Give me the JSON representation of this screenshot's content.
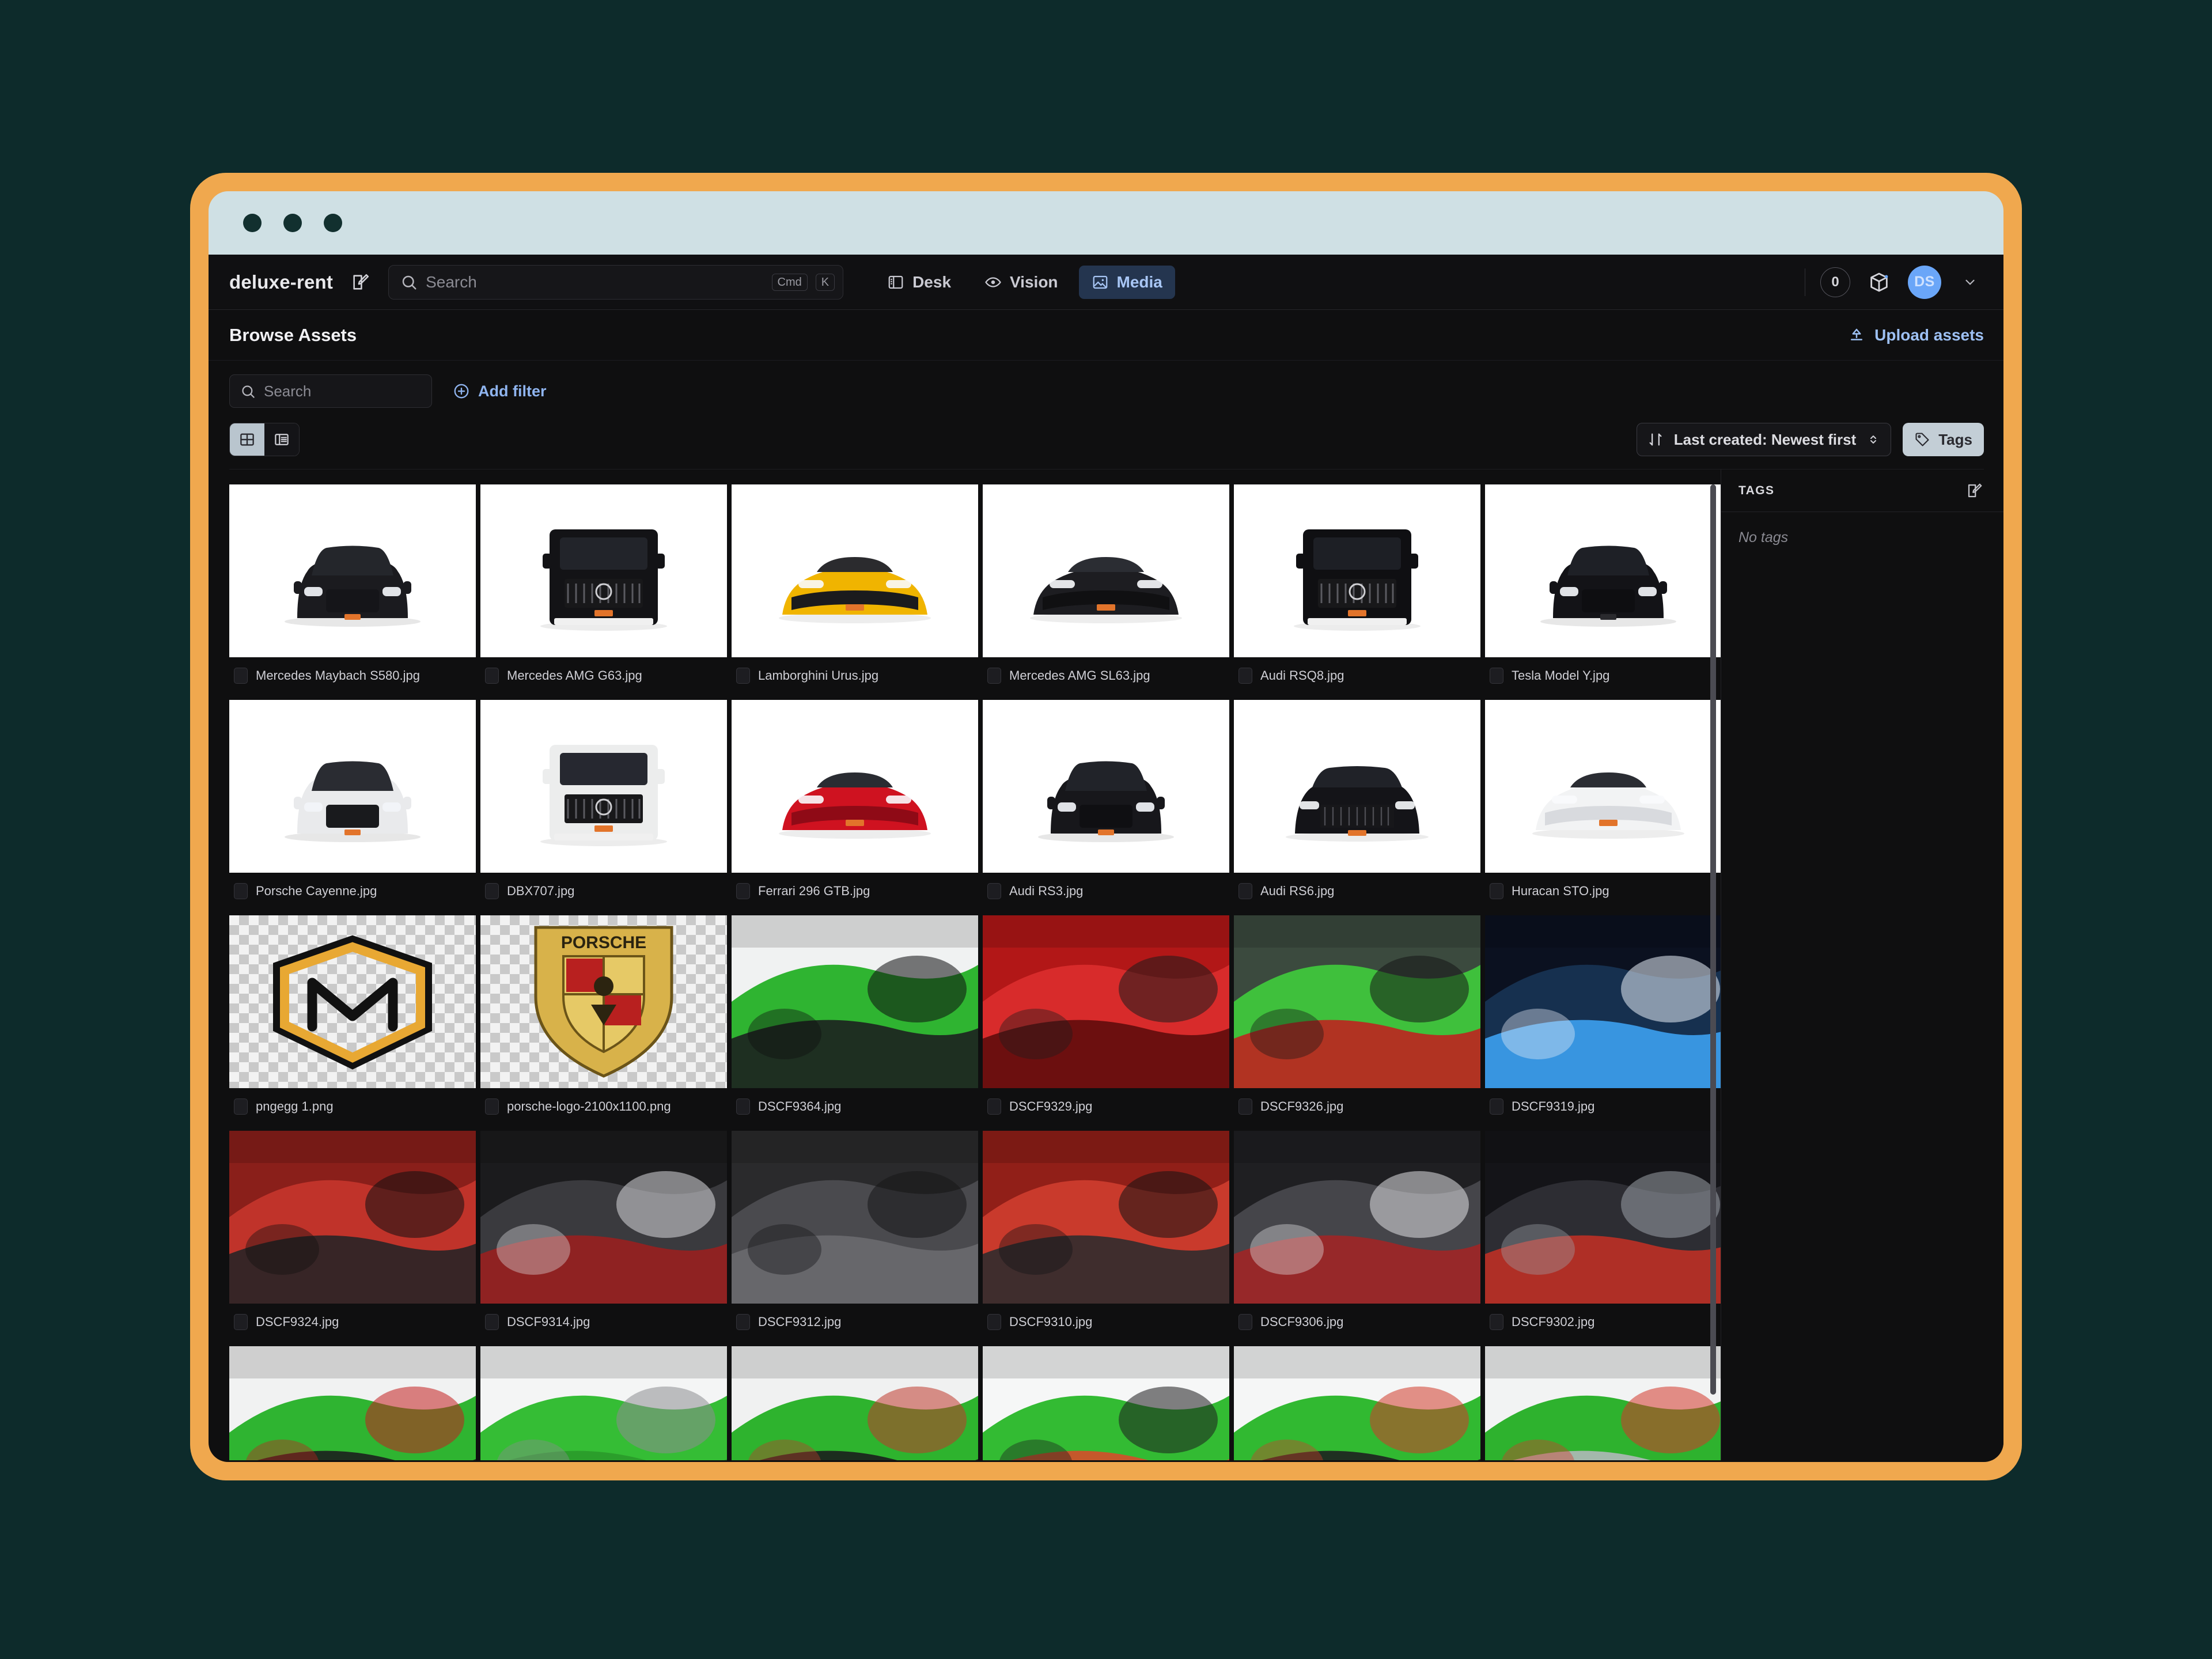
{
  "window": {
    "frame_color": "#f0a84e",
    "titlebar_color": "#cfe0e4",
    "background_color": "#0d2b2b",
    "traffic_lights": [
      "close",
      "minimize",
      "maximize"
    ]
  },
  "appbar": {
    "brand": "deluxe-rent",
    "edit_icon": "edit-square-icon",
    "search": {
      "placeholder": "Search",
      "value": "",
      "kbd_mod": "Cmd",
      "kbd_key": "K"
    },
    "tabs": [
      {
        "label": "Desk",
        "icon": "layout-panel-icon",
        "active": false
      },
      {
        "label": "Vision",
        "icon": "eye-icon",
        "active": false
      },
      {
        "label": "Media",
        "icon": "image-icon",
        "active": true
      }
    ],
    "count_badge": "0",
    "package_icon": "package-icon",
    "avatar_initials": "DS",
    "avatar_color": "#6aa6f8",
    "chevron_icon": "chevron-down-icon"
  },
  "page": {
    "title": "Browse Assets",
    "upload_label": "Upload assets",
    "upload_icon": "upload-icon"
  },
  "toolbar": {
    "search": {
      "placeholder": "Search",
      "value": "",
      "icon": "search-icon"
    },
    "add_filter_label": "Add filter",
    "add_filter_icon": "plus-circle-icon",
    "view_modes": [
      {
        "name": "grid",
        "icon": "grid-view-icon",
        "active": true
      },
      {
        "name": "list",
        "icon": "list-view-icon",
        "active": false
      }
    ],
    "sort": {
      "label": "Last created: Newest first",
      "icon": "sort-icon",
      "chevron": "chevron-updown-icon"
    },
    "tags_button": {
      "label": "Tags",
      "icon": "tag-icon"
    }
  },
  "tags_panel": {
    "header": "TAGS",
    "edit_icon": "edit-square-icon",
    "empty_text": "No tags"
  },
  "assets": [
    {
      "name": "Mercedes Maybach S580.jpg",
      "art": "car-front-dark",
      "bg": "#ffffff"
    },
    {
      "name": "Mercedes AMG G63.jpg",
      "art": "suv-boxy-dark",
      "bg": "#ffffff"
    },
    {
      "name": "Lamborghini Urus.jpg",
      "art": "car-front-yellow",
      "bg": "#ffffff"
    },
    {
      "name": "Mercedes AMG SL63.jpg",
      "art": "car-front-dark-low",
      "bg": "#ffffff"
    },
    {
      "name": "Audi RSQ8.jpg",
      "art": "suv-front-black",
      "bg": "#ffffff"
    },
    {
      "name": "Tesla Model Y.jpg",
      "art": "suv-front-black2",
      "bg": "#ffffff"
    },
    {
      "name": "Porsche Cayenne.jpg",
      "art": "suv-front-white",
      "bg": "#ffffff"
    },
    {
      "name": "DBX707.jpg",
      "art": "suv-front-white2",
      "bg": "#ffffff"
    },
    {
      "name": "Ferrari 296 GTB.jpg",
      "art": "car-front-red",
      "bg": "#ffffff"
    },
    {
      "name": "Audi RS3.jpg",
      "art": "car-front-black-sedan",
      "bg": "#ffffff"
    },
    {
      "name": "Audi RS6.jpg",
      "art": "wagon-front-black",
      "bg": "#ffffff"
    },
    {
      "name": "Huracan STO.jpg",
      "art": "car-front-white-super",
      "bg": "#ffffff"
    },
    {
      "name": "pngegg 1.png",
      "art": "maybach-logo",
      "bg": "checker"
    },
    {
      "name": "porsche-logo-2100x1100.png",
      "art": "porsche-logo",
      "bg": "checker"
    },
    {
      "name": "DSCF9364.jpg",
      "art": "green-car-side",
      "bg": "#eef0f0"
    },
    {
      "name": "DSCF9329.jpg",
      "art": "red-interior-seat",
      "bg": "#b31a1a"
    },
    {
      "name": "DSCF9326.jpg",
      "art": "green-door-open",
      "bg": "#2f3a33"
    },
    {
      "name": "DSCF9319.jpg",
      "art": "digital-cluster",
      "bg": "#0d1320"
    },
    {
      "name": "DSCF9324.jpg",
      "art": "red-cabin-wide",
      "bg": "#7d1c18"
    },
    {
      "name": "DSCF9314.jpg",
      "art": "steering-wheel-audi",
      "bg": "#1a1a1c"
    },
    {
      "name": "DSCF9312.jpg",
      "art": "center-vents",
      "bg": "#2a2a2c"
    },
    {
      "name": "DSCF9310.jpg",
      "art": "red-console",
      "bg": "#8d1f1b"
    },
    {
      "name": "DSCF9306.jpg",
      "art": "steering-wheel-red",
      "bg": "#1f1f22"
    },
    {
      "name": "DSCF9302.jpg",
      "art": "wheel-cluster-red",
      "bg": "#141418"
    },
    {
      "name": "",
      "art": "green-roof-detail",
      "bg": "#f1f2f2"
    },
    {
      "name": "",
      "art": "green-quarter-v10",
      "bg": "#f4f5f5"
    },
    {
      "name": "",
      "art": "green-rear-audi",
      "bg": "#f0f1f1"
    },
    {
      "name": "",
      "art": "green-rear-three-quarter",
      "bg": "#f6f7f7"
    },
    {
      "name": "",
      "art": "green-rear-plate",
      "bg": "#f5f6f6"
    },
    {
      "name": "",
      "art": "green-wheel-brake",
      "bg": "#f2f3f3"
    }
  ]
}
